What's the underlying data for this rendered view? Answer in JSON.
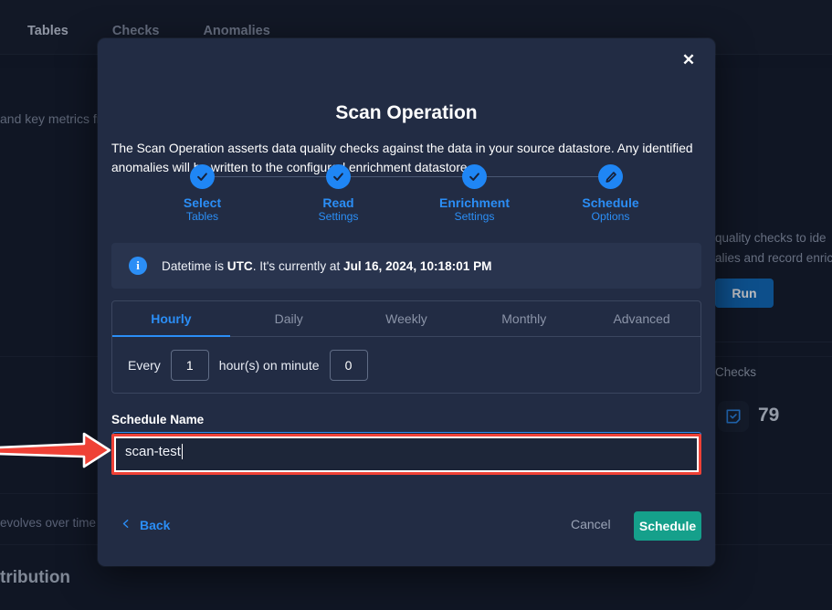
{
  "background": {
    "tabs": [
      {
        "label": "Tables",
        "active": true
      },
      {
        "label": "Checks",
        "active": false
      },
      {
        "label": "Anomalies",
        "active": false
      }
    ],
    "desc_left": "and key metrics fro",
    "desc_right_line1": "quality checks to ide",
    "desc_right_line2": "alies and record enrich",
    "run_label": "Run",
    "checks_label": "Checks",
    "checks_count": "79",
    "checks_icon": "check-square-icon",
    "evolves_text": "evolves over time",
    "distribution_heading": "tribution"
  },
  "modal": {
    "close_icon": "close-icon",
    "title": "Scan Operation",
    "description": "The Scan Operation asserts data quality checks against the data in your source datastore. Any identified anomalies will be written to the configured enrichment datastore",
    "stepper": [
      {
        "title": "Select",
        "sub": "Tables",
        "icon": "check-icon",
        "state": "complete"
      },
      {
        "title": "Read",
        "sub": "Settings",
        "icon": "check-icon",
        "state": "complete"
      },
      {
        "title": "Enrichment",
        "sub": "Settings",
        "icon": "check-icon",
        "state": "complete"
      },
      {
        "title": "Schedule",
        "sub": "Options",
        "icon": "pencil-icon",
        "state": "current"
      }
    ],
    "info": {
      "icon": "info-icon",
      "prefix": "Datetime is ",
      "timezone": "UTC",
      "middle": ". It's currently at ",
      "datetime": "Jul 16, 2024, 10:18:01 PM"
    },
    "schedule_tabs": [
      {
        "label": "Hourly",
        "active": true
      },
      {
        "label": "Daily",
        "active": false
      },
      {
        "label": "Weekly",
        "active": false
      },
      {
        "label": "Monthly",
        "active": false
      },
      {
        "label": "Advanced",
        "active": false
      }
    ],
    "hourly": {
      "every_label": "Every",
      "hours_value": "1",
      "middle_label": "hour(s) on minute",
      "minute_value": "0"
    },
    "schedule_name": {
      "label": "Schedule Name",
      "value": "scan-test",
      "placeholder": "Schedule Name"
    },
    "footer": {
      "back_icon": "chevron-left-icon",
      "back_label": "Back",
      "cancel_label": "Cancel",
      "schedule_label": "Schedule"
    }
  },
  "annotation": {
    "arrow_icon": "red-arrow-right-icon",
    "highlight_color": "#ef4136"
  },
  "colors": {
    "accent_blue": "#2b8ef6",
    "teal_button": "#15a08b",
    "modal_bg": "#222c44",
    "page_bg": "#131a29",
    "annotation_red": "#ef4136"
  }
}
